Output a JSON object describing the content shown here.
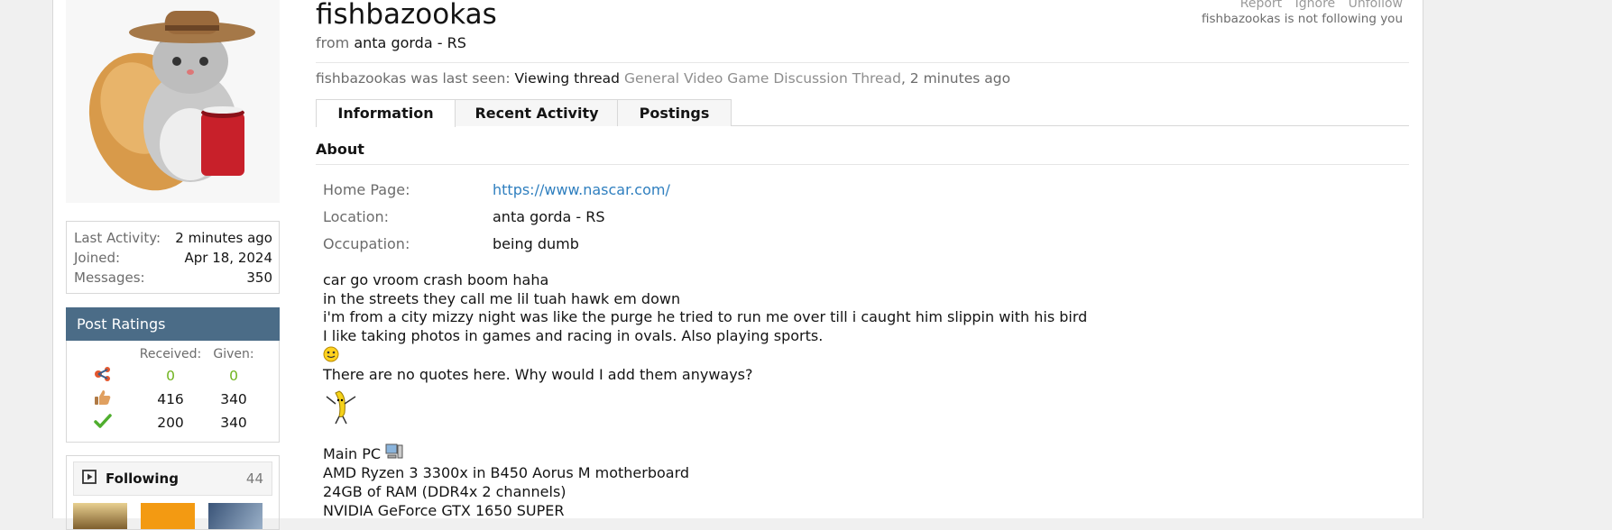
{
  "profile": {
    "username": "fishbazookas",
    "from_prefix": "from",
    "from_location": "anta gorda - RS",
    "actions": [
      "Report",
      "Ignore",
      "Unfollow"
    ],
    "not_following": "fishbazookas is not following you",
    "last_seen_prefix": "fishbazookas was last seen:",
    "last_seen_action": "Viewing thread",
    "last_seen_thread": "General Video Game Discussion Thread",
    "last_seen_time": ", 2 minutes ago"
  },
  "sidebar": {
    "stats": [
      {
        "label": "Last Activity:",
        "value": "2 minutes ago"
      },
      {
        "label": "Joined:",
        "value": "Apr 18, 2024"
      },
      {
        "label": "Messages:",
        "value": "350"
      }
    ],
    "ratings": {
      "title": "Post Ratings",
      "received_label": "Received:",
      "given_label": "Given:",
      "rows": [
        {
          "icon": "share-rating-icon",
          "received": "0",
          "given": "0"
        },
        {
          "icon": "thumbs-up-icon",
          "received": "416",
          "given": "340"
        },
        {
          "icon": "checkmark-icon",
          "received": "200",
          "given": "340"
        }
      ]
    },
    "following": {
      "title": "Following",
      "count": "44"
    }
  },
  "tabs": [
    "Information",
    "Recent Activity",
    "Postings"
  ],
  "about": {
    "heading": "About",
    "fields": [
      {
        "key": "Home Page:",
        "value": "https://www.nascar.com/"
      },
      {
        "key": "Location:",
        "value": "anta gorda - RS"
      },
      {
        "key": "Occupation:",
        "value": "being dumb"
      }
    ],
    "bio": [
      "car go vroom crash boom haha",
      "in the streets they call me lil tuah hawk em down",
      "i'm from a city mizzy night was like the purge he tried to run me over till i caught him slippin with his bird",
      "I like taking photos in games and racing in ovals. Also playing sports.",
      "There are no quotes here. Why would I add them anyways?",
      "Main PC",
      "AMD Ryzen 3 3300x in B450 Aorus M motherboard",
      "24GB of RAM (DDR4x 2 channels)",
      "NVIDIA GeForce GTX 1650 SUPER"
    ]
  },
  "colors": {
    "ratings_header": "#4b6c87",
    "link": "#2f7fbf",
    "positive": "#6fb31d"
  }
}
